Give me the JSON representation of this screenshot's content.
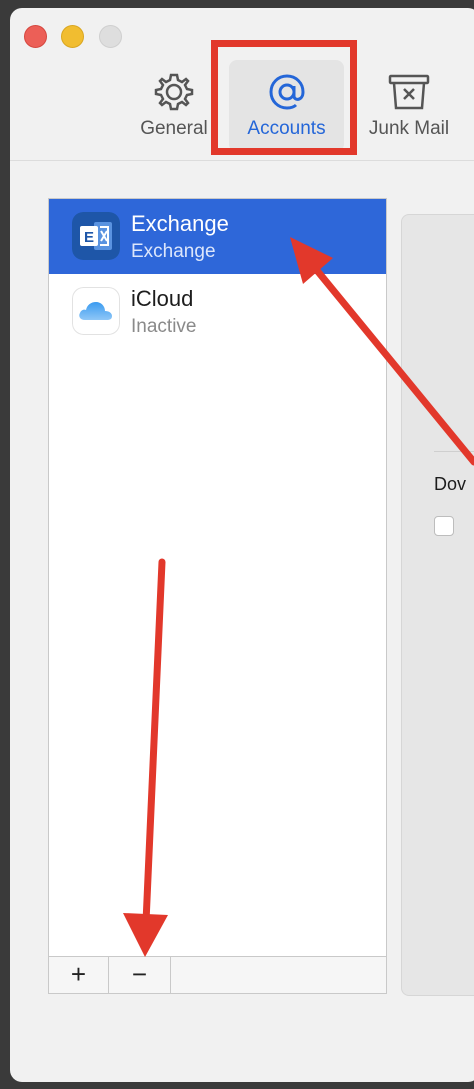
{
  "toolbar": {
    "general_label": "General",
    "accounts_label": "Accounts",
    "junk_label": "Junk Mail"
  },
  "accounts": [
    {
      "name": "Exchange",
      "status": "Exchange",
      "selected": true,
      "icon": "exchange-icon"
    },
    {
      "name": "iCloud",
      "status": "Inactive",
      "selected": false,
      "icon": "icloud-icon"
    }
  ],
  "list_controls": {
    "add": "+",
    "remove": "−"
  },
  "right_panel": {
    "download_label": "Dov"
  },
  "colors": {
    "accent": "#2466d8",
    "selection": "#2e67d9",
    "annotation": "#e2382b"
  }
}
